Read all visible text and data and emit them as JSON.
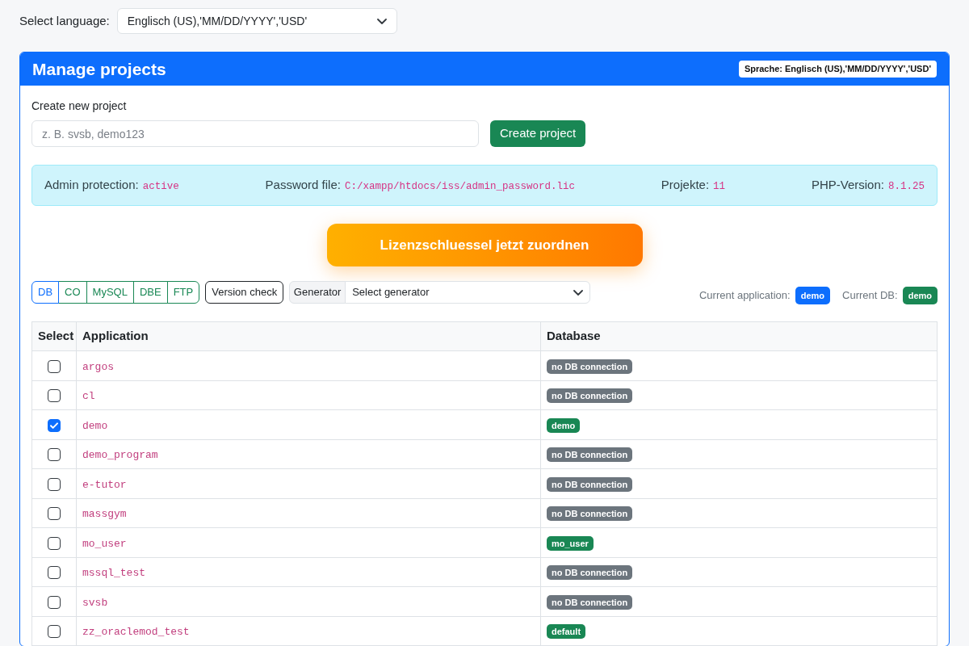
{
  "language": {
    "label": "Select language:",
    "value": "Englisch (US),'MM/DD/YYYY','USD'"
  },
  "card": {
    "title": "Manage projects",
    "badge": "Sprache: Englisch (US),'MM/DD/YYYY','USD'"
  },
  "create": {
    "label": "Create new project",
    "placeholder": "z. B. svsb, demo123",
    "button": "Create project"
  },
  "info": [
    {
      "label": "Admin protection:",
      "value": "active"
    },
    {
      "label": "Password file:",
      "value": "C:/xampp/htdocs/iss/admin_password.lic"
    },
    {
      "label": "Projekte:",
      "value": "11"
    },
    {
      "label": "PHP-Version:",
      "value": "8.1.25"
    }
  ],
  "license_button": "Lizenzschluessel jetzt zuordnen",
  "toolbar": {
    "buttons": [
      {
        "label": "DB",
        "color": "#0d6efd"
      },
      {
        "label": "CO",
        "color": "#198754"
      },
      {
        "label": "MySQL",
        "color": "#198754"
      },
      {
        "label": "DBE",
        "color": "#198754"
      },
      {
        "label": "FTP",
        "color": "#198754"
      }
    ],
    "version_button": "Version check",
    "generator": {
      "label": "Generator",
      "value": "Select generator"
    },
    "current": [
      {
        "label": "Current application:",
        "value": "demo",
        "color": "#0d6efd"
      },
      {
        "label": "Current DB:",
        "value": "demo",
        "color": "#198754"
      }
    ]
  },
  "table": {
    "columns": [
      "Select",
      "Application",
      "Database"
    ],
    "rows": [
      {
        "checked": false,
        "application": "argos",
        "database": {
          "label": "no DB connection",
          "connected": false
        }
      },
      {
        "checked": false,
        "application": "cl",
        "database": {
          "label": "no DB connection",
          "connected": false
        }
      },
      {
        "checked": true,
        "application": "demo",
        "database": {
          "label": "demo",
          "connected": true
        }
      },
      {
        "checked": false,
        "application": "demo_program",
        "database": {
          "label": "no DB connection",
          "connected": false
        }
      },
      {
        "checked": false,
        "application": "e-tutor",
        "database": {
          "label": "no DB connection",
          "connected": false
        }
      },
      {
        "checked": false,
        "application": "massgym",
        "database": {
          "label": "no DB connection",
          "connected": false
        }
      },
      {
        "checked": false,
        "application": "mo_user",
        "database": {
          "label": "mo_user",
          "connected": true
        }
      },
      {
        "checked": false,
        "application": "mssql_test",
        "database": {
          "label": "no DB connection",
          "connected": false
        }
      },
      {
        "checked": false,
        "application": "svsb",
        "database": {
          "label": "no DB connection",
          "connected": false
        }
      },
      {
        "checked": false,
        "application": "zz_oraclemod_test",
        "database": {
          "label": "default",
          "connected": true
        }
      }
    ]
  }
}
